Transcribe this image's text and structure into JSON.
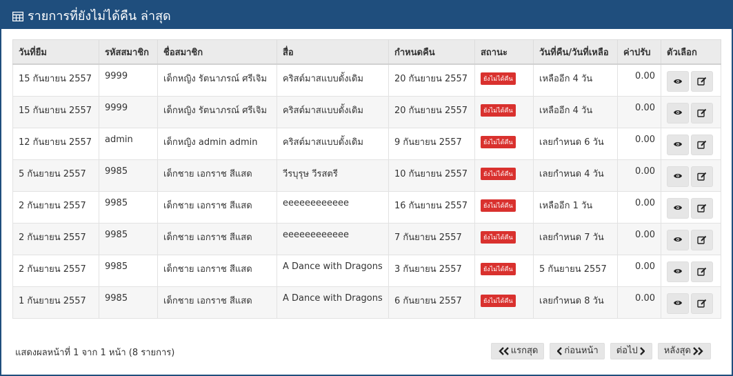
{
  "panel": {
    "title": "รายการที่ยังไม่ได้คืน ล่าสุด"
  },
  "table": {
    "headers": [
      "วันที่ยืม",
      "รหัสสมาชิก",
      "ชื่อสมาชิก",
      "สื่อ",
      "กำหนดคืน",
      "สถานะ",
      "วันที่คืน/วันที่เหลือ",
      "ค่าปรับ",
      "ตัวเลือก"
    ],
    "rows": [
      [
        "15 กันยายน 2557",
        "9999",
        "เด็กหญิง รัตนาภรณ์ ศรีเจิม",
        "คริสต์มาสแบบดั้งเดิม",
        "20 กันยายน 2557",
        "ยังไม่ได้คืน",
        "เหลืออีก 4 วัน",
        "0.00"
      ],
      [
        "15 กันยายน 2557",
        "9999",
        "เด็กหญิง รัตนาภรณ์ ศรีเจิม",
        "คริสต์มาสแบบดั้งเดิม",
        "20 กันยายน 2557",
        "ยังไม่ได้คืน",
        "เหลืออีก 4 วัน",
        "0.00"
      ],
      [
        "12 กันยายน 2557",
        "admin",
        "เด็กหญิง admin admin",
        "คริสต์มาสแบบดั้งเดิม",
        "9 กันยายน 2557",
        "ยังไม่ได้คืน",
        "เลยกำหนด 6 วัน",
        "0.00"
      ],
      [
        "5 กันยายน 2557",
        "9985",
        "เด็กชาย เอกราช สีแสด",
        "วีรบุรุษ วีรสตรี",
        "10 กันยายน 2557",
        "ยังไม่ได้คืน",
        "เลยกำหนด 4 วัน",
        "0.00"
      ],
      [
        "2 กันยายน 2557",
        "9985",
        "เด็กชาย เอกราช สีแสด",
        "eeeeeeeeeeee",
        "16 กันยายน 2557",
        "ยังไม่ได้คืน",
        "เหลืออีก 1 วัน",
        "0.00"
      ],
      [
        "2 กันยายน 2557",
        "9985",
        "เด็กชาย เอกราช สีแสด",
        "eeeeeeeeeeee",
        "7 กันยายน 2557",
        "ยังไม่ได้คืน",
        "เลยกำหนด 7 วัน",
        "0.00"
      ],
      [
        "2 กันยายน 2557",
        "9985",
        "เด็กชาย เอกราช สีแสด",
        "A Dance with Dragons",
        "3 กันยายน 2557",
        "ยังไม่ได้คืน",
        "5 กันยายน 2557",
        "0.00"
      ],
      [
        "1 กันยายน 2557",
        "9985",
        "เด็กชาย เอกราช สีแสด",
        "A Dance with Dragons",
        "6 กันยายน 2557",
        "ยังไม่ได้คืน",
        "เลยกำหนด 8 วัน",
        "0.00"
      ]
    ]
  },
  "footer": {
    "info": "แสดงผลหน้าที่ 1 จาก 1 หน้า (8 รายการ)",
    "first": "แรกสุด",
    "prev": "ก่อนหน้า",
    "next": "ต่อไป",
    "last": "หลังสุด"
  },
  "colors": {
    "header": "#1f4e7d",
    "badge": "#d9312e"
  }
}
